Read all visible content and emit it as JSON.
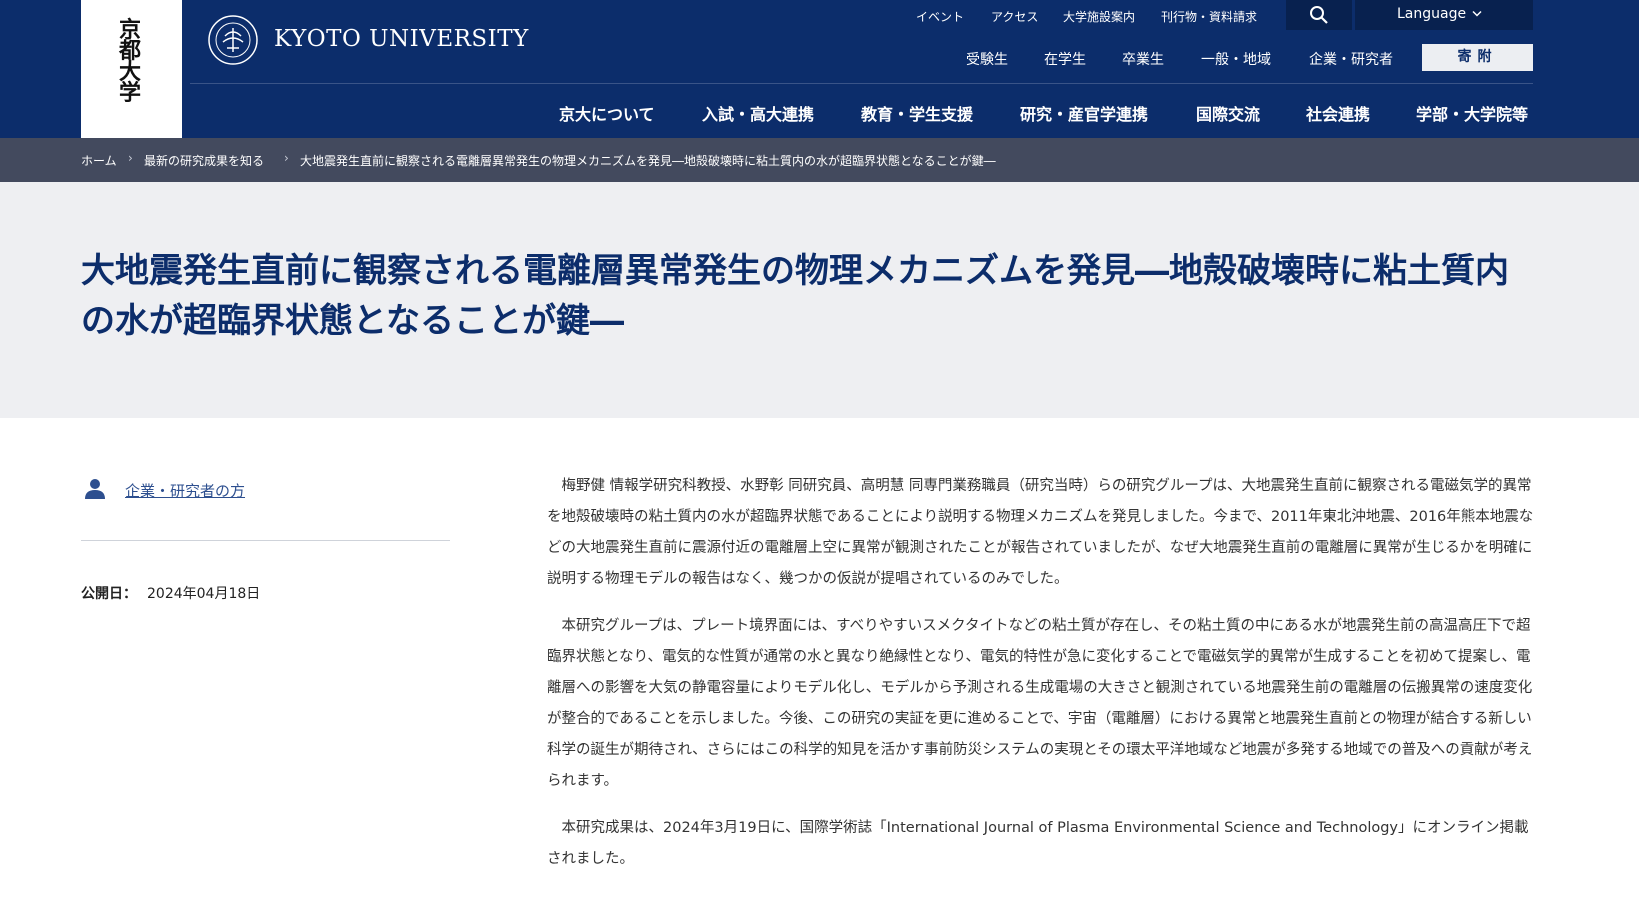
{
  "header": {
    "seal_text": "京都大学",
    "university_name": "KYOTO UNIVERSITY",
    "emblem_icon": "kyoto-university-emblem",
    "util_links": [
      "イベント",
      "アクセス",
      "大学施設案内",
      "刊行物・資料請求"
    ],
    "search_icon": "search-icon",
    "language_label": "Language",
    "audience_links": [
      "受験生",
      "在学生",
      "卒業生",
      "一般・地域",
      "企業・研究者"
    ],
    "donate_label": "寄附",
    "main_nav": [
      "京大について",
      "入試・高大連携",
      "教育・学生支援",
      "研究・産官学連携",
      "国際交流",
      "社会連携",
      "学部・大学院等"
    ]
  },
  "breadcrumb": [
    "ホーム",
    "最新の研究成果を知る",
    "大地震発生直前に観察される電離層異常発生の物理メカニズムを発見―地殻破壊時に粘土質内の水が超臨界状態となることが鍵―"
  ],
  "page": {
    "title": "大地震発生直前に観察される電離層異常発生の物理メカニズムを発見―地殻破壊時に粘土質内の水が超臨界状態となることが鍵―"
  },
  "sidebar": {
    "audience_link": "企業・研究者の方",
    "published_label": "公開日：",
    "published_date": "2024年04月18日"
  },
  "article": {
    "paragraphs": [
      "梅野健 情報学研究科教授、水野彰 同研究員、高明慧 同専門業務職員（研究当時）らの研究グループは、大地震発生直前に観察される電磁気学的異常を地殻破壊時の粘土質内の水が超臨界状態であることにより説明する物理メカニズムを発見しました。今まで、2011年東北沖地震、2016年熊本地震などの大地震発生直前に震源付近の電離層上空に異常が観測されたことが報告されていましたが、なぜ大地震発生直前の電離層に異常が生じるかを明確に説明する物理モデルの報告はなく、幾つかの仮説が提唱されているのみでした。",
      "本研究グループは、プレート境界面には、すべりやすいスメクタイトなどの粘土質が存在し、その粘土質の中にある水が地震発生前の高温高圧下で超臨界状態となり、電気的な性質が通常の水と異なり絶縁性となり、電気的特性が急に変化することで電磁気学的異常が生成することを初めて提案し、電離層への影響を大気の静電容量によりモデル化し、モデルから予測される生成電場の大きさと観測されている地震発生前の電離層の伝搬異常の速度変化が整合的であることを示しました。今後、この研究の実証を更に進めることで、宇宙（電離層）における異常と地震発生直前との物理が結合する新しい科学の誕生が期待され、さらにはこの科学的知見を活かす事前防災システムの実現とその環太平洋地域など地震が多発する地域での普及への貢献が考えられます。",
      "本研究成果は、2024年3月19日に、国際学術誌「International Journal of Plasma Environmental Science and Technology」にオンライン掲載されました。"
    ]
  }
}
